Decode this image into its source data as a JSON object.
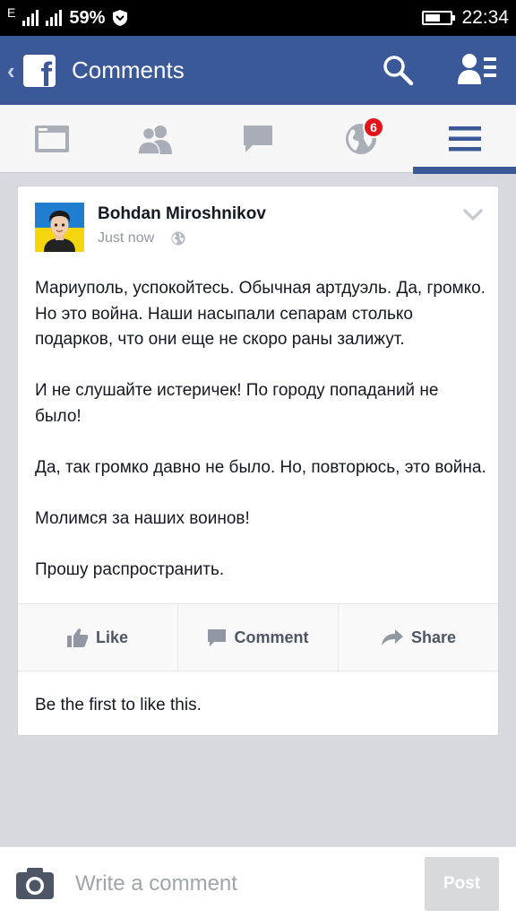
{
  "status_bar": {
    "network_type": "E",
    "battery_percent": "59%",
    "battery_level": 0.59,
    "time": "22:34"
  },
  "header": {
    "title": "Comments",
    "icons": [
      "back-chevron-icon",
      "facebook-logo",
      "search-icon",
      "friend-requests-icon"
    ]
  },
  "nav": {
    "tabs": [
      "news-feed",
      "friends",
      "messages",
      "notifications",
      "menu"
    ],
    "notifications_badge": "6",
    "active_tab": "menu"
  },
  "post": {
    "author": "Bohdan Miroshnikov",
    "timestamp": "Just now",
    "paragraphs": [
      "Мариуполь, успокойтесь. Обычная артдуэль. Да, громко. Но это война. Наши насыпали сепарам столько подарков, что они еще не скоро раны залижут.",
      "И не слушайте истеричек! По городу попаданий не было!",
      "Да, так громко давно не было. Но, повторюсь, это война.",
      "Молимся за наших воинов!",
      "Прошу распространить."
    ],
    "actions": {
      "like": "Like",
      "comment": "Comment",
      "share": "Share"
    },
    "likes_text": "Be the first to like this."
  },
  "composer": {
    "placeholder": "Write a comment",
    "post_label": "Post"
  },
  "colors": {
    "brand": "#3b5998",
    "badge": "#e3131b",
    "background": "#d8dadf"
  }
}
